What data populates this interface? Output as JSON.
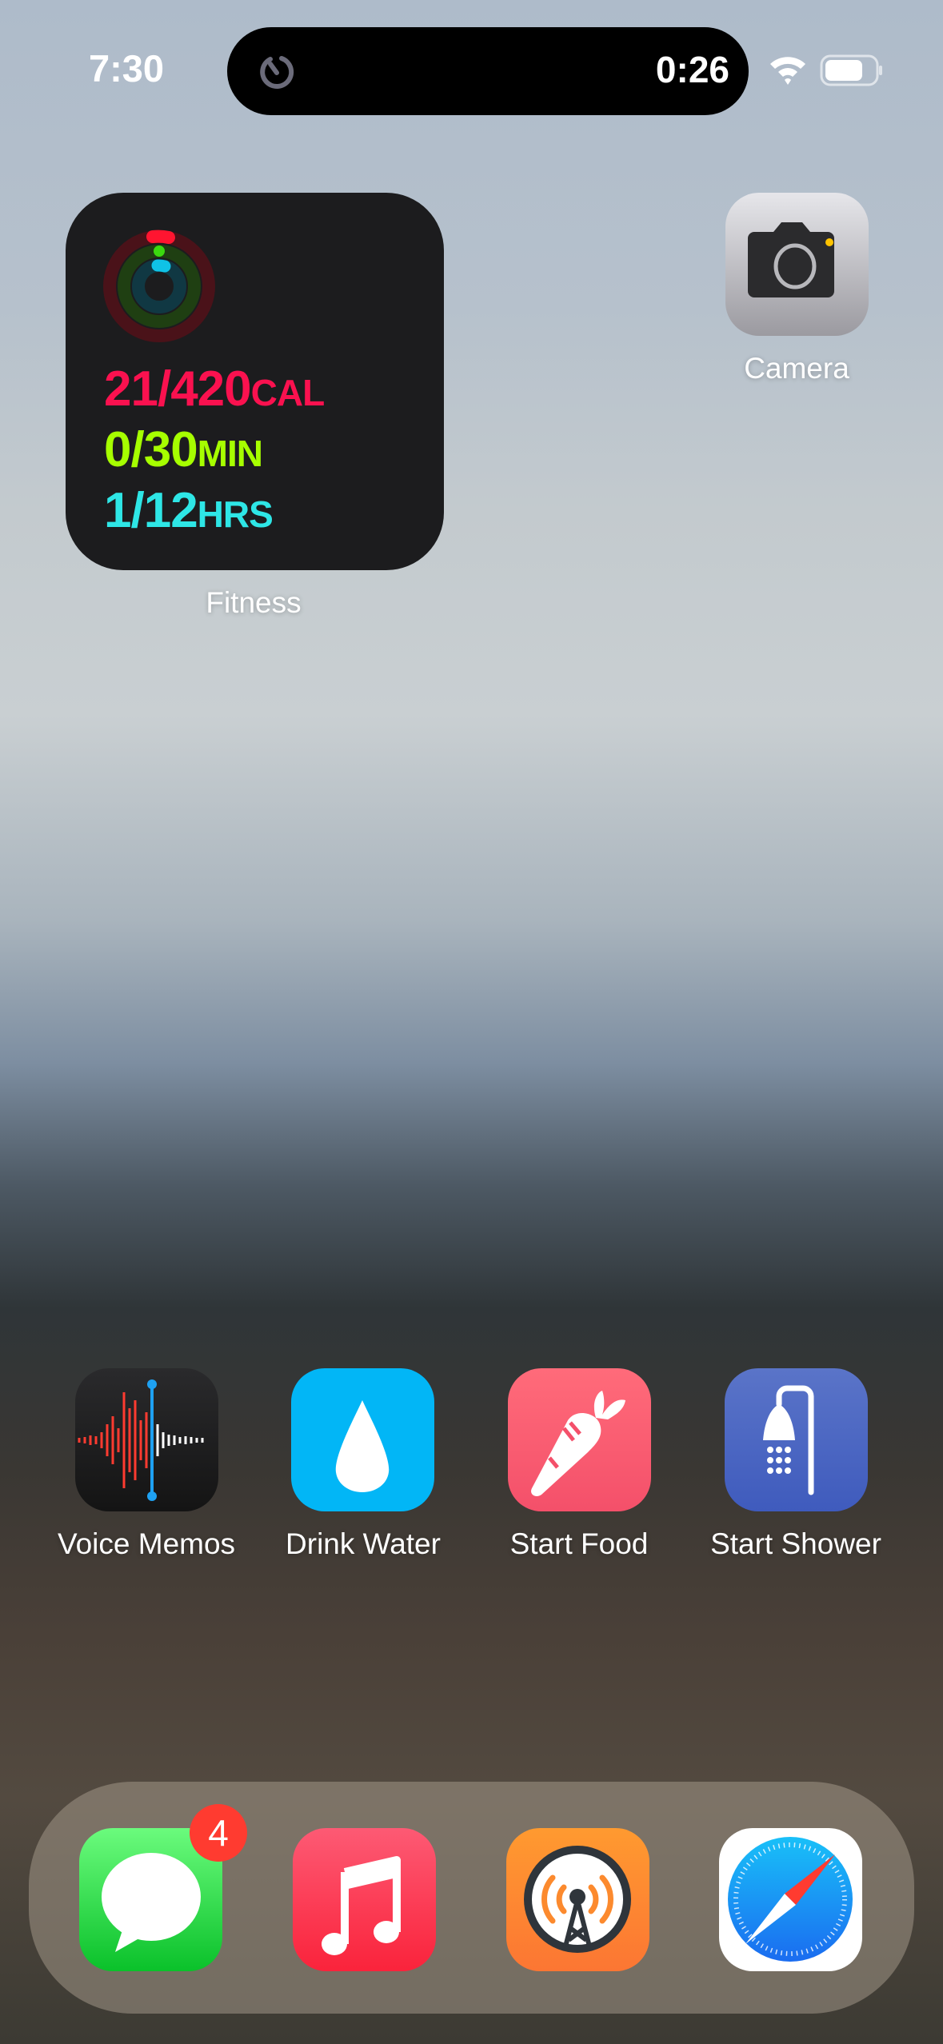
{
  "status_bar": {
    "time": "7:30",
    "timer": "0:26",
    "icons": [
      "timer-icon",
      "wifi-icon",
      "battery-icon"
    ]
  },
  "fitness_widget": {
    "label": "Fitness",
    "move": {
      "value": "21/420",
      "unit": "CAL",
      "color": "#fa114f",
      "progress": 0.05
    },
    "exercise": {
      "value": "0/30",
      "unit": "MIN",
      "color": "#a6ff00",
      "progress": 0
    },
    "stand": {
      "value": "1/12",
      "unit": "HRS",
      "color": "#2ee6e6",
      "progress": 0.083
    }
  },
  "apps": [
    {
      "label": "Camera"
    },
    {
      "label": "Voice Memos"
    },
    {
      "label": "Drink Water"
    },
    {
      "label": "Start Food"
    },
    {
      "label": "Start Shower"
    }
  ],
  "dock": {
    "apps": [
      {
        "name": "Messages",
        "badge": "4"
      },
      {
        "name": "Music"
      },
      {
        "name": "Overcast"
      },
      {
        "name": "Safari"
      }
    ]
  }
}
